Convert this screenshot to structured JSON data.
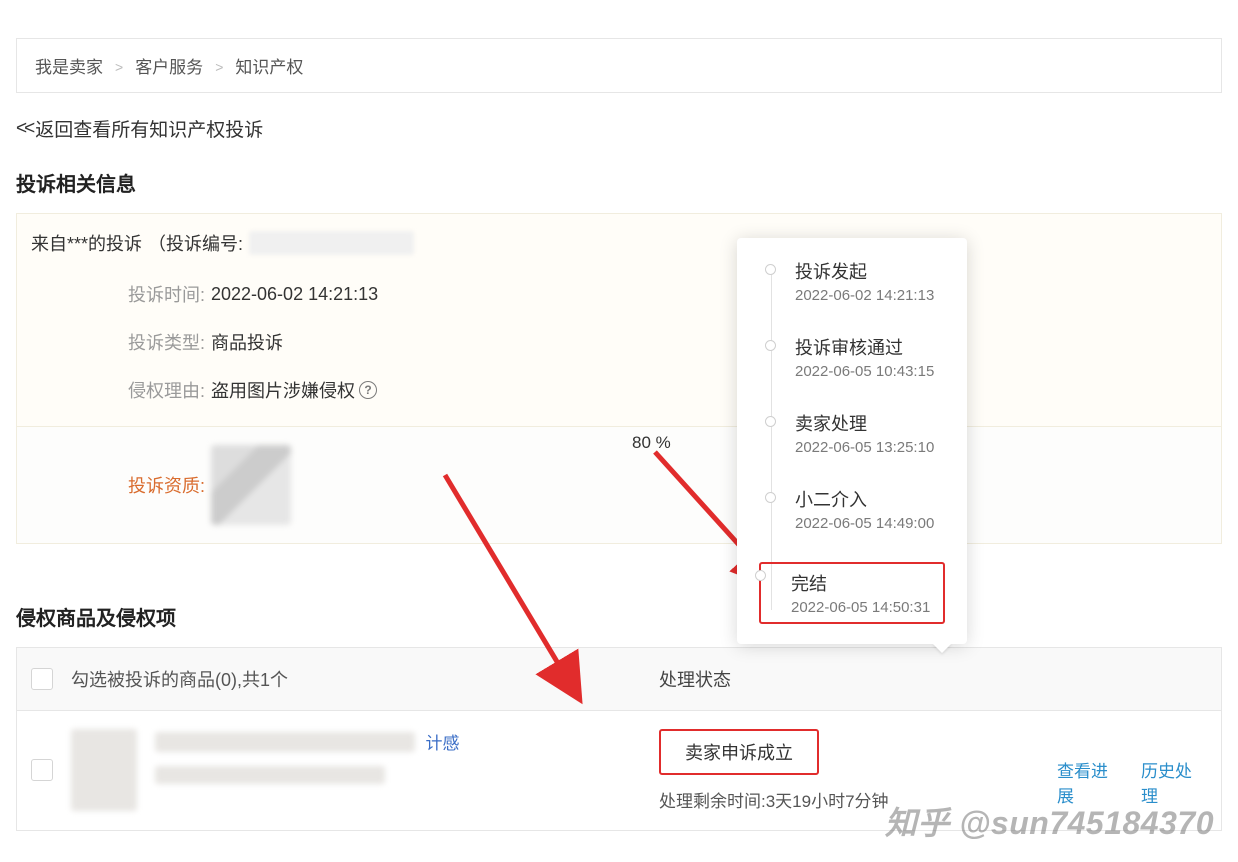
{
  "breadcrumb": {
    "a": "我是卖家",
    "b": "客户服务",
    "c": "知识产权"
  },
  "back_link": "返回查看所有知识产权投诉",
  "section1_title": "投诉相关信息",
  "complaint": {
    "from_prefix": "来自***的投诉",
    "id_label": "（投诉编号:",
    "time_label": "投诉时间:",
    "time_value": "2022-06-02 14:21:13",
    "type_label": "投诉类型:",
    "type_value": "商品投诉",
    "reason_label": "侵权理由:",
    "reason_value": "盗用图片涉嫌侵权",
    "qual_label": "投诉资质:",
    "percent": "80 %"
  },
  "timeline": [
    {
      "title": "投诉发起",
      "ts": "2022-06-02 14:21:13"
    },
    {
      "title": "投诉审核通过",
      "ts": "2022-06-05 10:43:15"
    },
    {
      "title": "卖家处理",
      "ts": "2022-06-05 13:25:10"
    },
    {
      "title": "小二介入",
      "ts": "2022-06-05 14:49:00"
    },
    {
      "title": "完结",
      "ts": "2022-06-05 14:50:31"
    }
  ],
  "section2_title": "侵权商品及侵权项",
  "list": {
    "header_text": "勾选被投诉的商品(0),共1个",
    "header_status": "处理状态",
    "item_title_tail": "计感",
    "status_value": "卖家申诉成立",
    "remain": "处理剩余时间:3天19小时7分钟",
    "action_view": "查看进展",
    "action_history": "历史处理"
  },
  "watermark": "知乎 @sun745184370",
  "glyphs": {
    "info": "?",
    "sep": ">"
  }
}
